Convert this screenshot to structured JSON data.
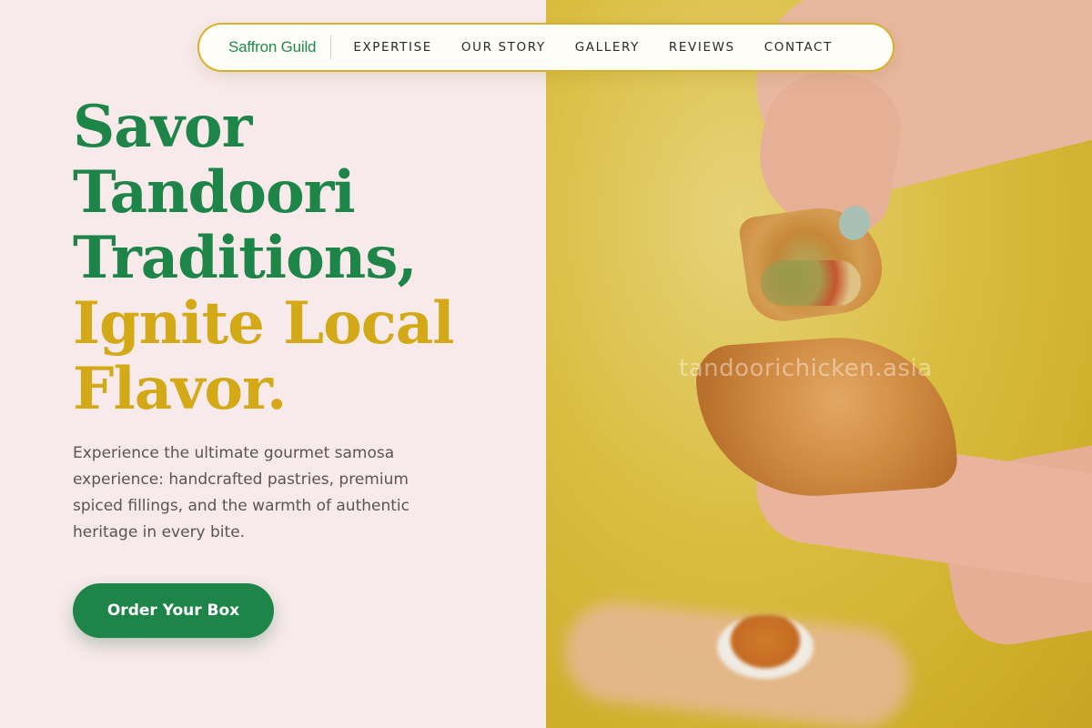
{
  "nav": {
    "brand": "Saffron Guild",
    "links": [
      "EXPERTISE",
      "OUR STORY",
      "GALLERY",
      "REVIEWS",
      "CONTACT"
    ]
  },
  "hero": {
    "headline_green": [
      "Savor",
      "Tandoori",
      "Traditions,"
    ],
    "headline_gold": [
      "Ignite Local",
      "Flavor."
    ],
    "description": "Experience the ultimate gourmet samosa experience: handcrafted pastries, premium spiced fillings, and the warmth of authentic heritage in every bite.",
    "cta_label": "Order Your Box"
  },
  "image": {
    "watermark": "tandoorichicken.asia"
  },
  "colors": {
    "brand_green": "#1e8549",
    "accent_gold": "#d4a917",
    "background_pink": "#f8eaea"
  }
}
